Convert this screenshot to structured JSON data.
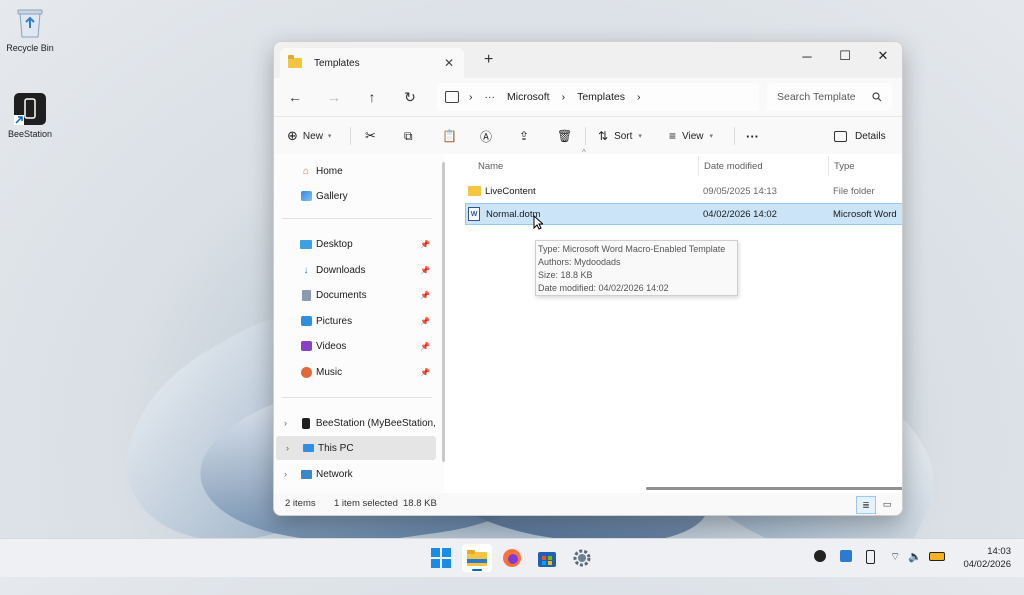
{
  "desktop": {
    "icons": [
      {
        "label": "Recycle Bin",
        "icon": "recycle-bin-icon"
      },
      {
        "label": "BeeStation",
        "icon": "beestation-shortcut-icon"
      }
    ]
  },
  "window": {
    "tab_title": "Templates",
    "new_tab": "+",
    "controls": {
      "minimize": "─",
      "maximize": "☐",
      "close": "✕"
    },
    "breadcrumb": {
      "overflow": "···",
      "sep": "›",
      "items": [
        "Microsoft",
        "Templates"
      ]
    },
    "search_placeholder": "Search Template"
  },
  "commandbar": {
    "new_label": "New",
    "sort_label": "Sort",
    "view_label": "View",
    "more_label": "···",
    "details_label": "Details"
  },
  "nav": {
    "quick": [
      {
        "label": "Home",
        "icon": "home-icon"
      },
      {
        "label": "Gallery",
        "icon": "gallery-icon"
      }
    ],
    "pinned": [
      {
        "label": "Desktop",
        "icon": "desktop-icon"
      },
      {
        "label": "Downloads",
        "icon": "downloads-icon"
      },
      {
        "label": "Documents",
        "icon": "documents-icon"
      },
      {
        "label": "Pictures",
        "icon": "pictures-icon"
      },
      {
        "label": "Videos",
        "icon": "videos-icon"
      },
      {
        "label": "Music",
        "icon": "music-icon"
      }
    ],
    "locations": [
      {
        "label": "BeeStation (MyBeeStation, Be",
        "icon": "beestation-icon"
      },
      {
        "label": "This PC",
        "icon": "this-pc-icon"
      },
      {
        "label": "Network",
        "icon": "network-icon"
      }
    ]
  },
  "files": {
    "columns": [
      "Name",
      "Date modified",
      "Type"
    ],
    "rows": [
      {
        "name": "LiveContent",
        "date": "09/05/2025 14:13",
        "type": "File folder",
        "icon": "folder-icon"
      },
      {
        "name": "Normal.dotm",
        "date": "04/02/2026 14:02",
        "type": "Microsoft Word",
        "icon": "word-document-icon"
      }
    ]
  },
  "tooltip": {
    "type": "Type: Microsoft Word Macro-Enabled Template",
    "authors": "Authors: Mydoodads",
    "size": "Size: 18.8 KB",
    "date": "Date modified: 04/02/2026 14:02"
  },
  "status": {
    "items": "2 items",
    "selected": "1 item selected",
    "size": "18.8 KB"
  },
  "taskbar": {
    "time": "14:03",
    "date": "04/02/2026"
  },
  "colors": {
    "accent": "#0067c0",
    "selection": "#cce4f7",
    "folder": "#f4c542",
    "word": "#2b579a"
  }
}
